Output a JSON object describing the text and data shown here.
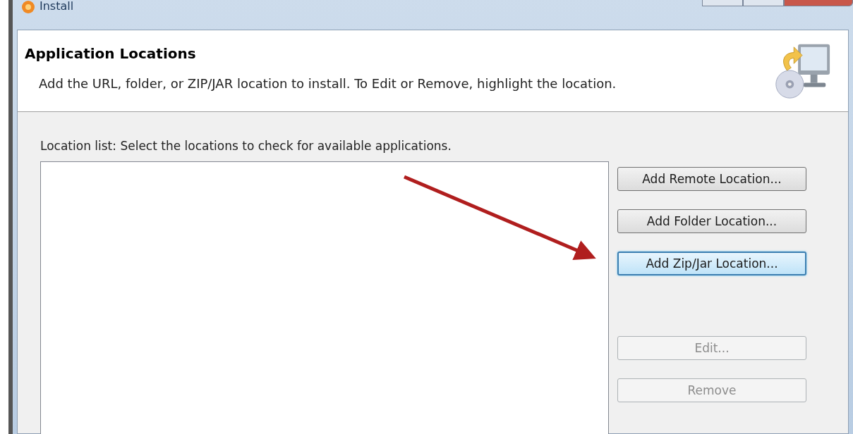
{
  "window": {
    "title": "Install"
  },
  "header": {
    "title": "Application Locations",
    "description": "Add the URL, folder, or ZIP/JAR location to install. To Edit or Remove, highlight the location."
  },
  "location_list": {
    "label": "Location list: Select the locations to check for available applications."
  },
  "buttons": [
    {
      "label": "Add Remote Location...",
      "focused": false,
      "disabled": false
    },
    {
      "label": "Add Folder Location...",
      "focused": false,
      "disabled": false
    },
    {
      "label": "Add Zip/Jar Location...",
      "focused": true,
      "disabled": false
    },
    {
      "label": "Edit...",
      "focused": false,
      "disabled": true,
      "gap_before": true
    },
    {
      "label": "Remove",
      "focused": false,
      "disabled": true
    }
  ]
}
